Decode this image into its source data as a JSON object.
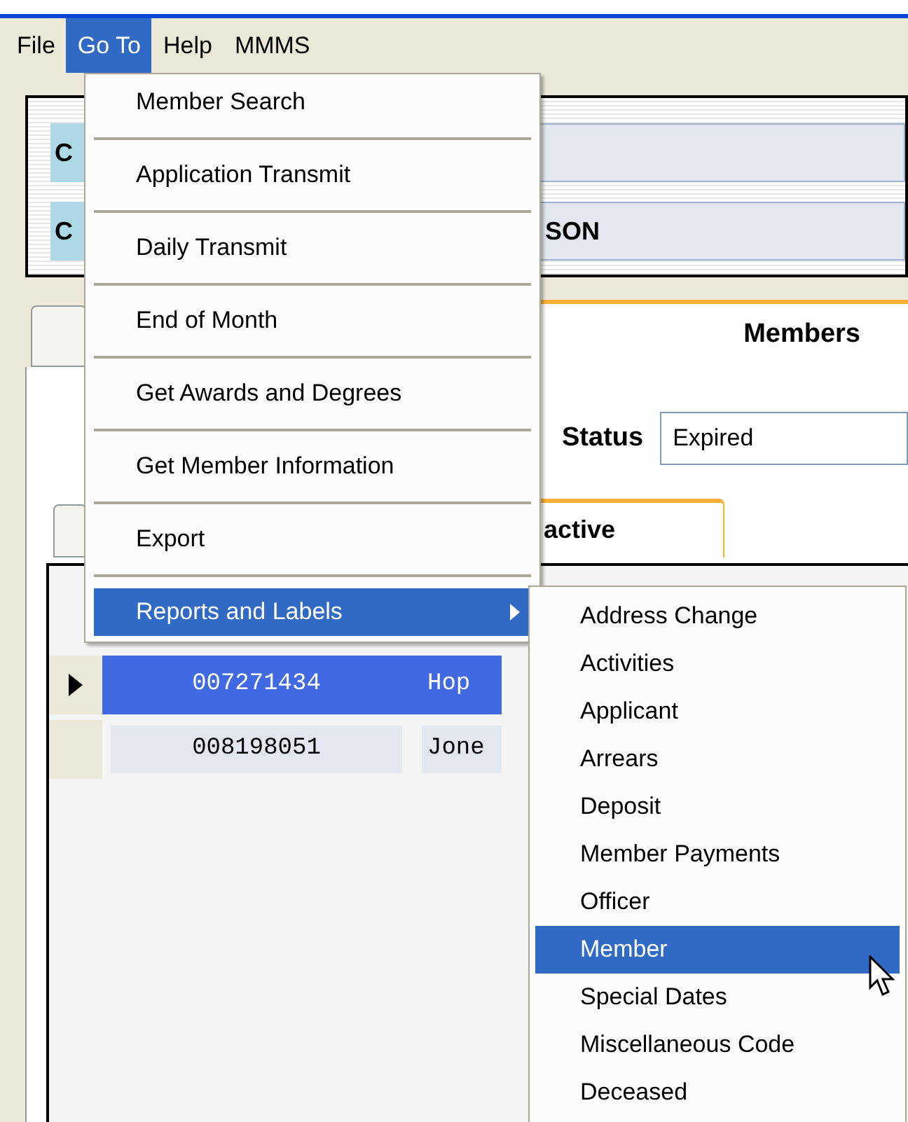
{
  "menu_bar": [
    {
      "label": "File",
      "selected": false
    },
    {
      "label": "Go To",
      "selected": true
    },
    {
      "label": "Help",
      "selected": false
    },
    {
      "label": "MMMS",
      "selected": false
    }
  ],
  "header_fields": [
    {
      "label": "C"
    },
    {
      "label": "C",
      "value": "SON"
    }
  ],
  "main_tab": {
    "title": "Members"
  },
  "status": {
    "label": "Status",
    "value": "Expired"
  },
  "inner_tab": {
    "label": "active"
  },
  "grid_rows": [
    {
      "selected": true,
      "cells": [
        "007271434",
        "Hop"
      ]
    },
    {
      "selected": false,
      "cells": [
        "008198051",
        "Jone"
      ]
    }
  ],
  "goto_menu": [
    {
      "label": "Member Search",
      "selected": false,
      "has_submenu": false
    },
    {
      "label": "Application Transmit",
      "selected": false,
      "has_submenu": false
    },
    {
      "label": "Daily Transmit",
      "selected": false,
      "has_submenu": false
    },
    {
      "label": "End of Month",
      "selected": false,
      "has_submenu": false
    },
    {
      "label": "Get Awards and Degrees",
      "selected": false,
      "has_submenu": false
    },
    {
      "label": "Get Member Information",
      "selected": false,
      "has_submenu": false
    },
    {
      "label": "Export",
      "selected": false,
      "has_submenu": false
    },
    {
      "label": "Reports and Labels",
      "selected": true,
      "has_submenu": true
    }
  ],
  "submenu": [
    {
      "label": "Address Change",
      "selected": false
    },
    {
      "label": "Activities",
      "selected": false
    },
    {
      "label": "Applicant",
      "selected": false
    },
    {
      "label": "Arrears",
      "selected": false
    },
    {
      "label": "Deposit",
      "selected": false
    },
    {
      "label": "Member Payments",
      "selected": false
    },
    {
      "label": "Officer",
      "selected": false
    },
    {
      "label": "Member",
      "selected": true
    },
    {
      "label": "Special Dates",
      "selected": false
    },
    {
      "label": "Miscellaneous Code",
      "selected": false
    },
    {
      "label": "Deceased",
      "selected": false
    }
  ]
}
